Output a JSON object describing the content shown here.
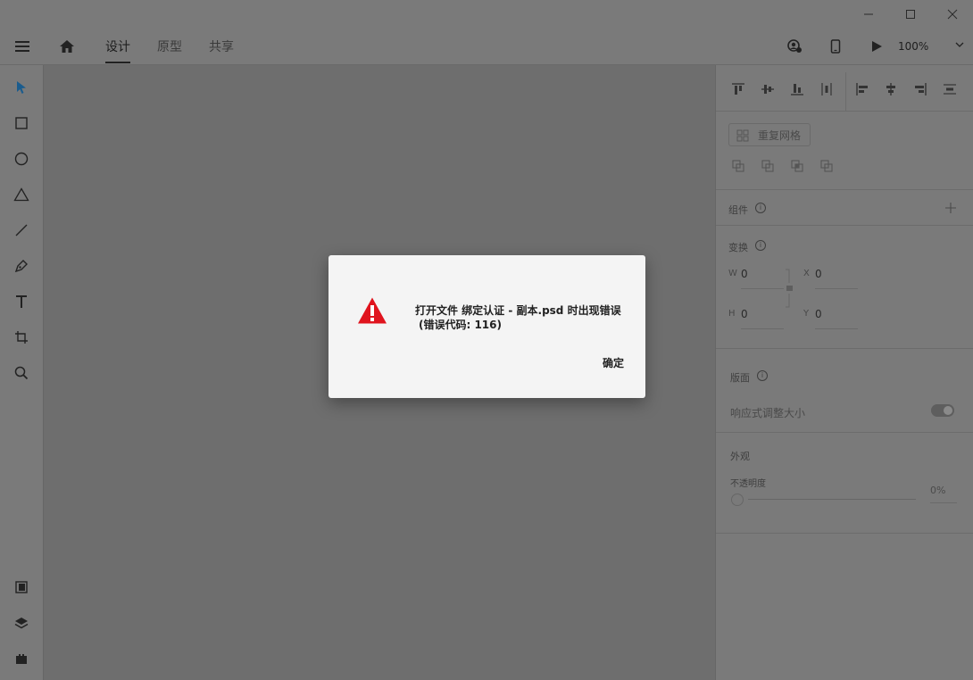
{
  "window_controls": {
    "minimize_icon": "minimize-icon",
    "maximize_icon": "maximize-icon",
    "close_icon": "close-icon"
  },
  "header": {
    "tabs": [
      {
        "label": "设计",
        "active": true
      },
      {
        "label": "原型",
        "active": false
      },
      {
        "label": "共享",
        "active": false
      }
    ],
    "zoom": "100%"
  },
  "toolbar": {
    "tools": [
      "select-icon",
      "rectangle-icon",
      "ellipse-icon",
      "triangle-icon",
      "line-icon",
      "pen-icon",
      "text-icon",
      "artboard-icon",
      "zoom-icon"
    ],
    "bottom": [
      "assets-icon",
      "layers-icon",
      "plugins-icon"
    ]
  },
  "right_panel": {
    "repeat_grid_label": "重复网格",
    "component_label": "组件",
    "transform_label": "变换",
    "w_label": "W",
    "w_value": "0",
    "x_label": "X",
    "x_value": "0",
    "h_label": "H",
    "h_value": "0",
    "y_label": "Y",
    "y_value": "0",
    "artboard_label": "版面",
    "responsive_label": "响应式调整大小",
    "appearance_label": "外观",
    "opacity_label": "不透明度",
    "opacity_value": "0%"
  },
  "dialog": {
    "message_line1": "打开文件 绑定认证 - 副本.psd 时出现错误",
    "message_line2": "(错误代码: 116)",
    "ok_label": "确定",
    "icon": "warning-icon",
    "icon_color": "#e0141e"
  }
}
